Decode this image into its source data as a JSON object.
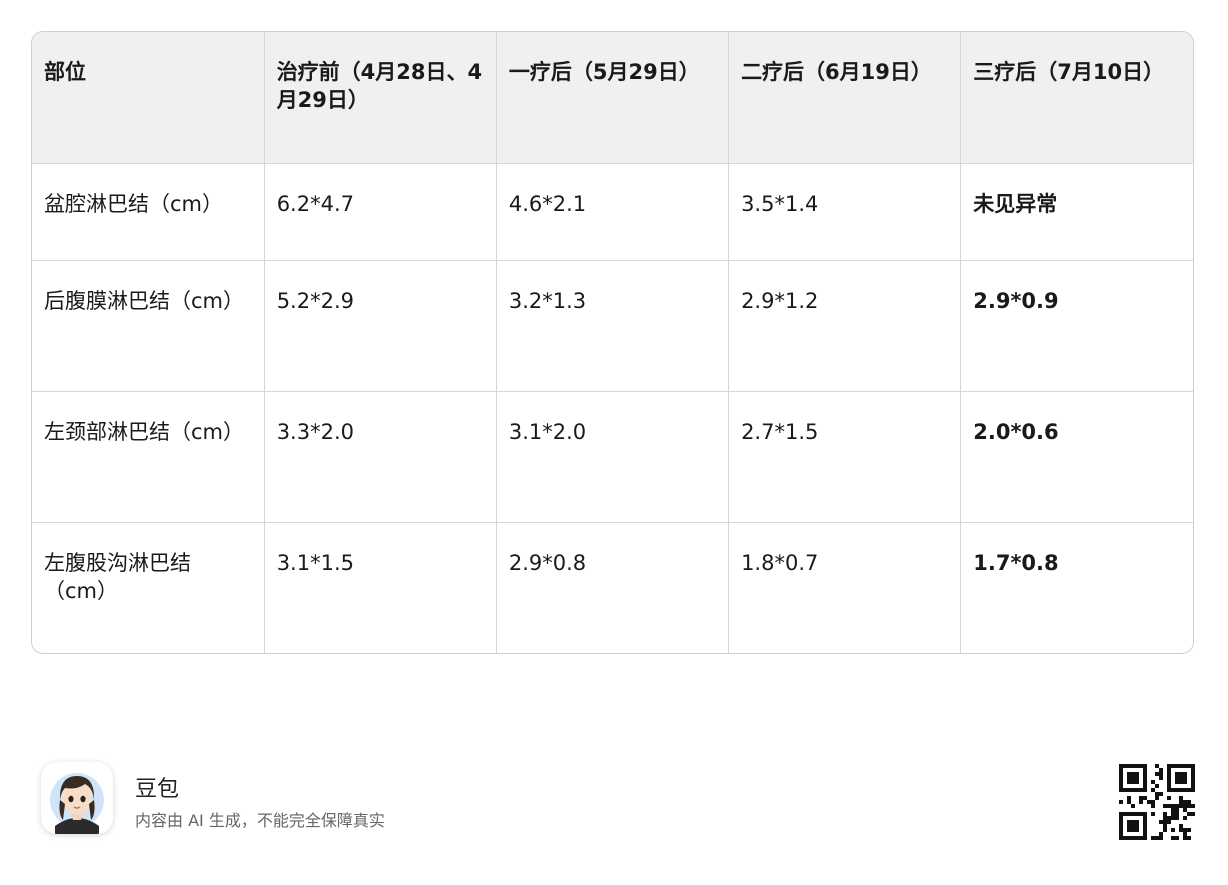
{
  "table": {
    "headers": [
      "部位",
      "治疗前（4月28日、4月29日）",
      "一疗后（5月29日）",
      "二疗后（6月19日）",
      "三疗后（7月10日）"
    ],
    "rows": [
      {
        "site": "盆腔淋巴结（cm）",
        "before": "6.2*4.7",
        "t1": "4.6*2.1",
        "t2": "3.5*1.4",
        "t3": "未见异常"
      },
      {
        "site": "后腹膜淋巴结（cm）",
        "before": "5.2*2.9",
        "t1": "3.2*1.3",
        "t2": "2.9*1.2",
        "t3": "2.9*0.9"
      },
      {
        "site": "左颈部淋巴结（cm）",
        "before": "3.3*2.0",
        "t1": "3.1*2.0",
        "t2": "2.7*1.5",
        "t3": "2.0*0.6"
      },
      {
        "site": "左腹股沟淋巴结（cm）",
        "before": "3.1*1.5",
        "t1": "2.9*0.8",
        "t2": "1.8*0.7",
        "t3": "1.7*0.8"
      }
    ]
  },
  "footer": {
    "brand": "豆包",
    "note": "内容由 AI 生成，不能完全保障真实",
    "avatar_icon": "girl-avatar-icon",
    "qr_icon": "qr-code-icon"
  }
}
